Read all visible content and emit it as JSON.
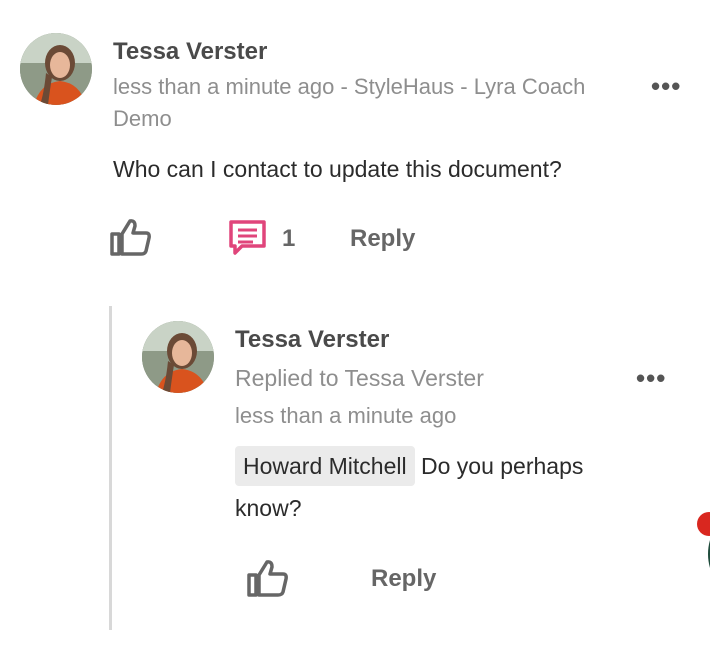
{
  "comment": {
    "author": "Tessa Verster",
    "meta": "less than a minute ago - StyleHaus - Lyra Coach Demo",
    "text": "Who can I contact to update this document?",
    "reply_count": "1",
    "reply_label": "Reply",
    "more_label": "•••"
  },
  "reply": {
    "author": "Tessa Verster",
    "replied_to": "Replied to Tessa Verster",
    "time": "less than a minute ago",
    "mention": "Howard Mitchell",
    "text": "Do you perhaps know?",
    "reply_label": "Reply",
    "more_label": "•••"
  },
  "colors": {
    "accent_comment_icon": "#e0457b",
    "icon_gray": "#666666",
    "badge_red": "#d9271f",
    "badge_green": "#1f4c3c"
  }
}
